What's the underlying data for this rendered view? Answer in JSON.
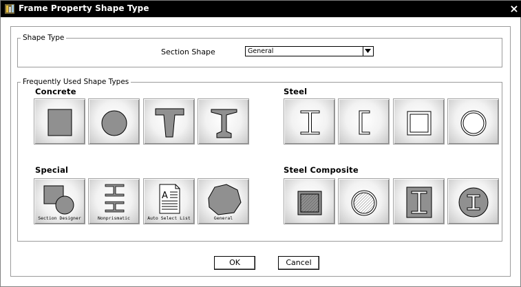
{
  "window": {
    "title": "Frame Property Shape Type",
    "close": "×"
  },
  "shape_type": {
    "legend": "Shape Type",
    "section_shape_label": "Section Shape",
    "section_shape_value": "General"
  },
  "frequent": {
    "legend": "Frequently Used Shape Types",
    "concrete_heading": "Concrete",
    "steel_heading": "Steel",
    "special_heading": "Special",
    "steel_composite_heading": "Steel Composite",
    "special_captions": [
      "Section Designer",
      "Nonprismatic",
      "Auto Select List",
      "General"
    ]
  },
  "buttons": {
    "ok": "OK",
    "cancel": "Cancel"
  }
}
